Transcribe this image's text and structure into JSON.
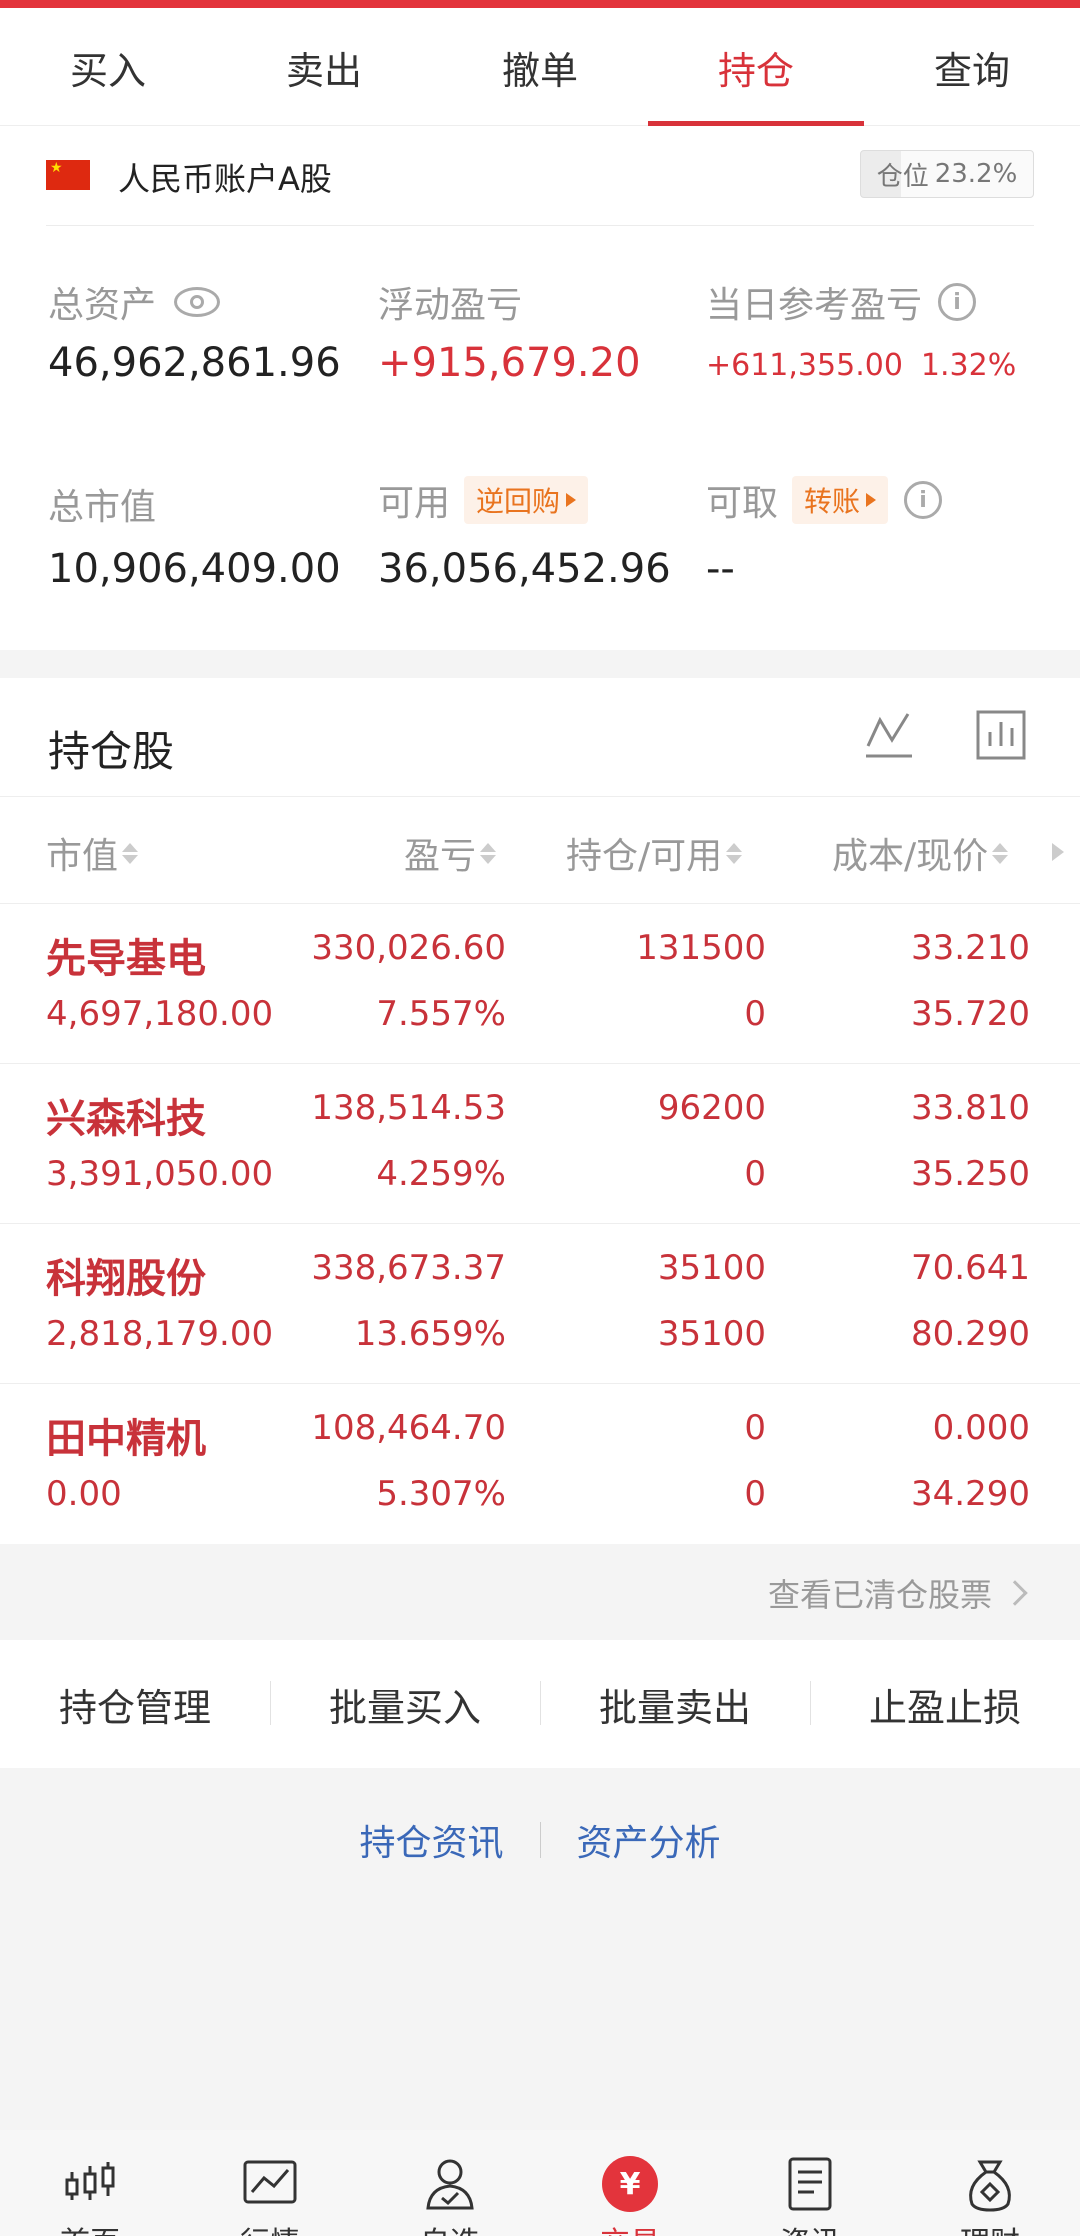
{
  "tabs": [
    {
      "label": "买入"
    },
    {
      "label": "卖出"
    },
    {
      "label": "撤单"
    },
    {
      "label": "持仓",
      "active": true
    },
    {
      "label": "查询"
    }
  ],
  "account": {
    "flag_icon": "china-flag-icon",
    "name": "人民币账户A股",
    "position_label": "仓位",
    "position_value": "23.2%",
    "position_fraction": 0.232
  },
  "summary": {
    "total_assets_label": "总资产",
    "total_assets": "46,962,861.96",
    "floating_pl_label": "浮动盈亏",
    "floating_pl": "+915,679.20",
    "daily_pl_label": "当日参考盈亏",
    "daily_pl": "+611,355.00",
    "daily_pl_pct": "1.32%",
    "market_value_label": "总市值",
    "market_value": "10,906,409.00",
    "available_label": "可用",
    "available_tag": "逆回购",
    "available": "36,056,452.96",
    "withdrawable_label": "可取",
    "withdrawable_tag": "转账",
    "withdrawable": "--"
  },
  "holdings": {
    "title": "持仓股",
    "columns": {
      "market_value": "市值",
      "pl": "盈亏",
      "position": "持仓/可用",
      "cost_price": "成本/现价"
    },
    "rows": [
      {
        "name": "先导基电",
        "market_value": "4,697,180.00",
        "pl": "330,026.60",
        "pl_pct": "7.557%",
        "position": "131500",
        "available": "0",
        "cost": "33.210",
        "price": "35.720"
      },
      {
        "name": "兴森科技",
        "market_value": "3,391,050.00",
        "pl": "138,514.53",
        "pl_pct": "4.259%",
        "position": "96200",
        "available": "0",
        "cost": "33.810",
        "price": "35.250"
      },
      {
        "name": "科翔股份",
        "market_value": "2,818,179.00",
        "pl": "338,673.37",
        "pl_pct": "13.659%",
        "position": "35100",
        "available": "35100",
        "cost": "70.641",
        "price": "80.290"
      },
      {
        "name": "田中精机",
        "market_value": "0.00",
        "pl": "108,464.70",
        "pl_pct": "5.307%",
        "position": "0",
        "available": "0",
        "cost": "0.000",
        "price": "34.290"
      }
    ],
    "cleared_link": "查看已清仓股票"
  },
  "actions": [
    "持仓管理",
    "批量买入",
    "批量卖出",
    "止盈止损"
  ],
  "links": [
    "持仓资讯",
    "资产分析"
  ],
  "bottom_nav": [
    {
      "label": "首页",
      "icon": "candlestick-icon"
    },
    {
      "label": "行情",
      "icon": "line-chart-icon"
    },
    {
      "label": "自选",
      "icon": "user-check-icon"
    },
    {
      "label": "交易",
      "icon": "yen-icon",
      "active": true,
      "glyph": "¥"
    },
    {
      "label": "资讯",
      "icon": "document-icon"
    },
    {
      "label": "理财",
      "icon": "money-bag-icon"
    }
  ],
  "colors": {
    "accent": "#d8323a",
    "link": "#3a68b8",
    "tag": "#e9741f"
  }
}
